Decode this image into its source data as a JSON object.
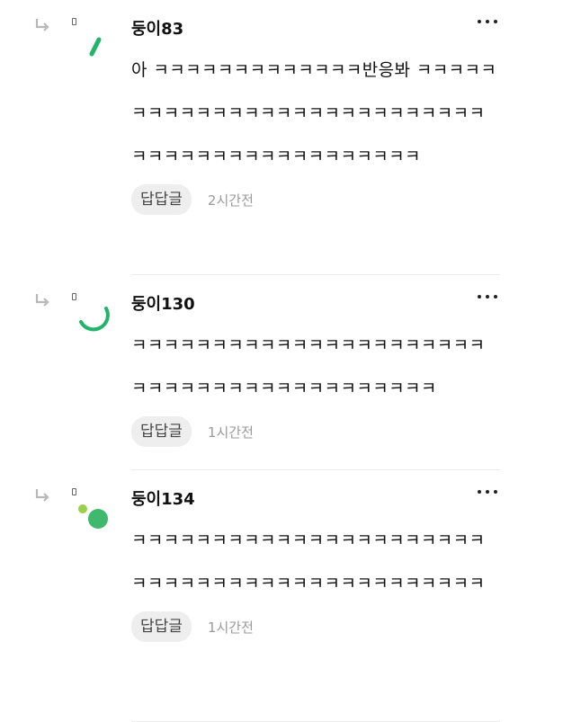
{
  "comments": [
    {
      "author": "둥이83",
      "text": "아 ㅋㅋㅋㅋㅋㅋㅋㅋㅋㅋㅋㅋㅋ반응봐 ㅋㅋㅋㅋㅋㅋㅋㅋㅋㅋㅋㅋㅋㅋㅋㅋㅋㅋㅋㅋㅋㅋㅋㅋㅋㅋㅋㅋㅋㅋㅋㅋㅋㅋㅋㅋㅋㅋㅋㅋㅋㅋㅋㅋㅋ",
      "reply_label": "답답글",
      "time": "2시간전"
    },
    {
      "author": "둥이130",
      "text": "ㅋㅋㅋㅋㅋㅋㅋㅋㅋㅋㅋㅋㅋㅋㅋㅋㅋㅋㅋㅋㅋㅋㅋㅋㅋㅋㅋㅋㅋㅋㅋㅋㅋㅋㅋㅋㅋㅋㅋㅋㅋ",
      "reply_label": "답답글",
      "time": "1시간전"
    },
    {
      "author": "둥이134",
      "text": "ㅋㅋㅋㅋㅋㅋㅋㅋㅋㅋㅋㅋㅋㅋㅋㅋㅋㅋㅋㅋㅋㅋㅋㅋㅋㅋㅋㅋㅋㅋㅋㅋㅋㅋㅋㅋㅋㅋㅋㅋㅋㅋㅋㅋ",
      "reply_label": "답답글",
      "time": "1시간전"
    }
  ],
  "icons": {
    "reply_arrow": "reply-arrow-icon",
    "more": "more-options-icon"
  },
  "colors": {
    "avatar_green": "#23b36b",
    "avatar_lime": "#9bcf4a",
    "avatar_dot": "#3fb96d"
  }
}
